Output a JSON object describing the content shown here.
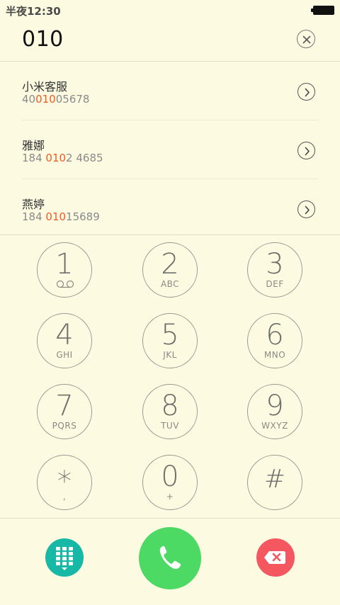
{
  "status_bar": {
    "time": "半夜12:30"
  },
  "dialer": {
    "input_number": "010"
  },
  "results": [
    {
      "name": "小米客服",
      "number_prefix": "40",
      "number_match": "010",
      "number_suffix": "05678"
    },
    {
      "name": "雅娜",
      "number_prefix": "184 ",
      "number_match": "010",
      "number_suffix": "2 4685"
    },
    {
      "name": "燕婷",
      "number_prefix": "184 ",
      "number_match": "010",
      "number_suffix": "15689"
    }
  ],
  "keypad": [
    {
      "digit": "1",
      "letters": "",
      "icon": "voicemail-icon"
    },
    {
      "digit": "2",
      "letters": "ABC"
    },
    {
      "digit": "3",
      "letters": "DEF"
    },
    {
      "digit": "4",
      "letters": "GHI"
    },
    {
      "digit": "5",
      "letters": "JKL"
    },
    {
      "digit": "6",
      "letters": "MNO"
    },
    {
      "digit": "7",
      "letters": "PQRS"
    },
    {
      "digit": "8",
      "letters": "TUV"
    },
    {
      "digit": "9",
      "letters": "WXYZ"
    },
    {
      "digit": "*",
      "letters": ","
    },
    {
      "digit": "0",
      "letters": "+"
    },
    {
      "digit": "#",
      "letters": ""
    }
  ],
  "bottom_bar": {
    "keypad_button_icon": "dialpad-icon",
    "call_button_icon": "phone-icon",
    "delete_button_icon": "backspace-icon"
  },
  "colors": {
    "background": "#fcfbe1",
    "highlight": "#f05b25",
    "keypad_button": "#17b8a6",
    "call_button": "#4cd964",
    "delete_button": "#f4575f"
  }
}
